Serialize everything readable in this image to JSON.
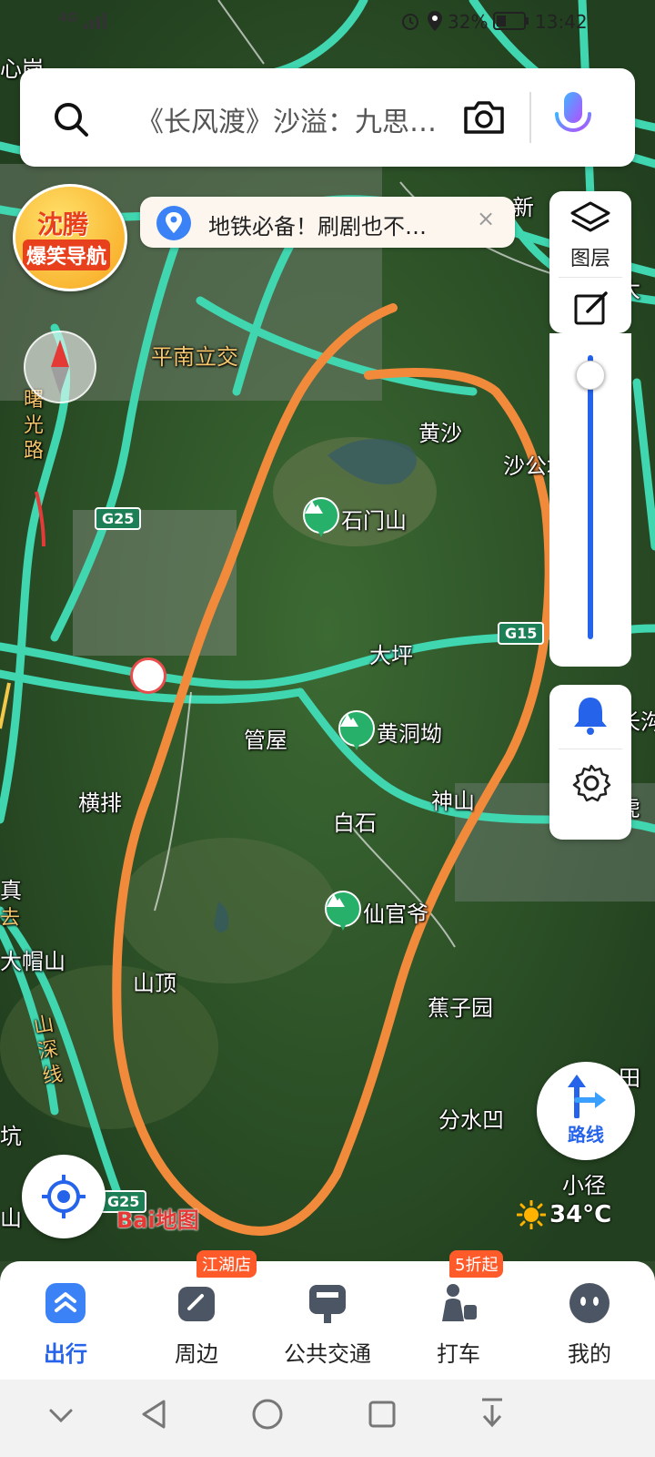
{
  "status_bar": {
    "network": "4G",
    "battery": "32%",
    "time": "13:42"
  },
  "search": {
    "placeholder": "《长风渡》沙溢：九思…"
  },
  "tip_banner": {
    "text": "地铁必备！刷剧也不…",
    "close": "×"
  },
  "promo_badge": {
    "line1": "沈腾",
    "line2": "爆笑导航"
  },
  "right_tools": {
    "layers_label": "图层",
    "zoom_level": 0.02
  },
  "map": {
    "roads": [
      "曙光路",
      "山深线"
    ],
    "shields": [
      "G25",
      "G15",
      "G25"
    ],
    "places": [
      "心岗",
      "新",
      "大",
      "平南立交",
      "黄沙",
      "沙公坳",
      "大坪",
      "管屋",
      "横排",
      "神山",
      "白石",
      "山顶",
      "蕉子园",
      "分水凹",
      "小径",
      "长沟",
      "虎",
      "真",
      "去",
      "大帽山",
      "坑",
      "山",
      "田"
    ],
    "pois": [
      "石门山",
      "黄洞坳",
      "仙官爷"
    ],
    "logo": "Bai地图",
    "annotation_color": "#f28a3c"
  },
  "weather": {
    "temp": "34°C"
  },
  "route_button": {
    "label": "路线"
  },
  "tabs": [
    {
      "label": "出行",
      "active": true
    },
    {
      "label": "周边",
      "badge": "江湖店"
    },
    {
      "label": "公共交通"
    },
    {
      "label": "打车",
      "badge": "5折起"
    },
    {
      "label": "我的"
    }
  ],
  "colors": {
    "accent": "#2563eb",
    "road": "#3fd6b0",
    "poi": "#27b06a"
  }
}
